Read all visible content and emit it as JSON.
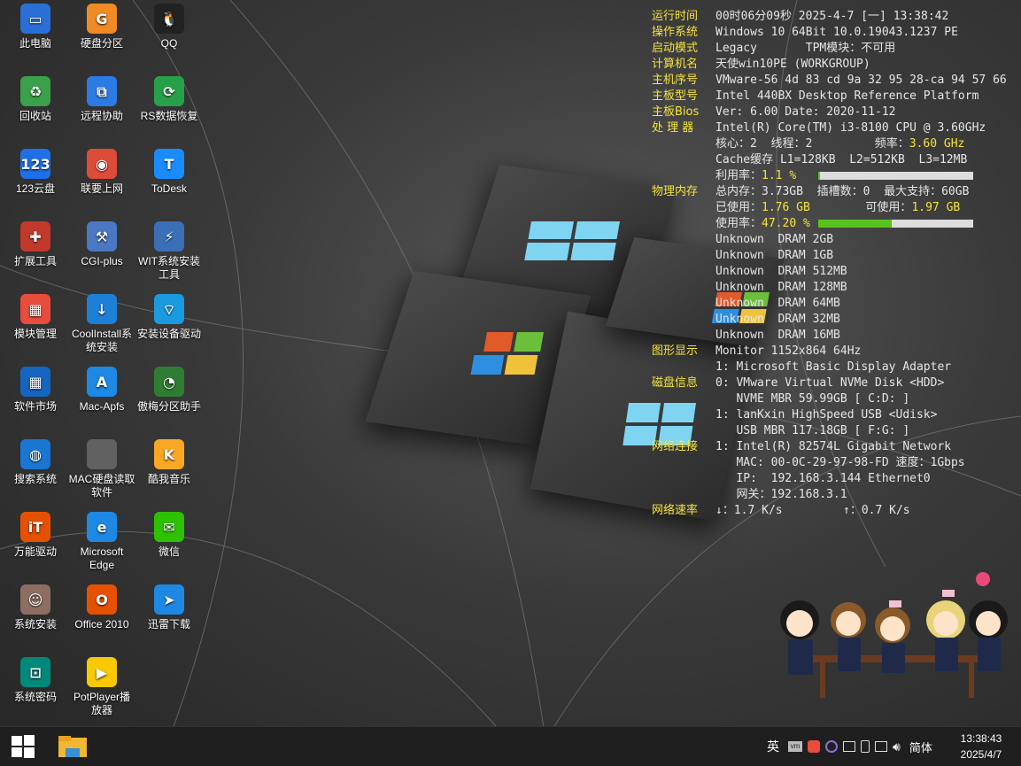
{
  "desktop_icons": [
    {
      "label": "此电脑",
      "glyph": "▭",
      "color": "#2a6fd6"
    },
    {
      "label": "硬盘分区",
      "glyph": "G",
      "color": "#f08a24"
    },
    {
      "label": "QQ",
      "glyph": "🐧",
      "color": "#222222"
    },
    {
      "label": "回收站",
      "glyph": "♻",
      "color": "#3aa04a"
    },
    {
      "label": "远程协助",
      "glyph": "⧉",
      "color": "#2c7be5"
    },
    {
      "label": "RS数据恢复",
      "glyph": "⟳",
      "color": "#27a04a"
    },
    {
      "label": "123云盘",
      "glyph": "123",
      "color": "#1e6fe8"
    },
    {
      "label": "联要上网",
      "glyph": "◉",
      "color": "#dd4b39"
    },
    {
      "label": "ToDesk",
      "glyph": "T",
      "color": "#1a8cff"
    },
    {
      "label": "扩展工具",
      "glyph": "✚",
      "color": "#c0392b"
    },
    {
      "label": "CGI-plus",
      "glyph": "⚒",
      "color": "#4a78c2"
    },
    {
      "label": "WIT系统安装工具",
      "glyph": "⚡",
      "color": "#3b6fb6"
    },
    {
      "label": "模块管理",
      "glyph": "▦",
      "color": "#e74c3c"
    },
    {
      "label": "CoolInstall系统安装",
      "glyph": "↓",
      "color": "#1d7fd6"
    },
    {
      "label": "安装设备驱动",
      "glyph": "⌔",
      "color": "#1a9be0"
    },
    {
      "label": "软件市场",
      "glyph": "▦",
      "color": "#1565c0"
    },
    {
      "label": "Mac-Apfs",
      "glyph": "A",
      "color": "#1e88e5"
    },
    {
      "label": "傲梅分区助手",
      "glyph": "◔",
      "color": "#2e7d32"
    },
    {
      "label": "搜索系统",
      "glyph": "◍",
      "color": "#1976d2"
    },
    {
      "label": "MAC硬盘读取软件",
      "glyph": "",
      "color": "#616161"
    },
    {
      "label": "酷我音乐",
      "glyph": "K",
      "color": "#f9a825"
    },
    {
      "label": "万能驱动",
      "glyph": "iT",
      "color": "#e65100"
    },
    {
      "label": "Microsoft Edge",
      "glyph": "e",
      "color": "#1e88e5"
    },
    {
      "label": "微信",
      "glyph": "✉",
      "color": "#2dc100"
    },
    {
      "label": "系统安装",
      "glyph": "☺",
      "color": "#8d6e63"
    },
    {
      "label": "Office 2010",
      "glyph": "O",
      "color": "#e65100"
    },
    {
      "label": "迅雷下载",
      "glyph": "➤",
      "color": "#1e88e5"
    },
    {
      "label": "系统密码",
      "glyph": "⊡",
      "color": "#00897b"
    },
    {
      "label": "PotPlayer播放器",
      "glyph": "▶",
      "color": "#f9c900"
    }
  ],
  "info": {
    "runtime": {
      "label": "运行时间",
      "value": "00时06分09秒 2025-4-7 [一] 13:38:42"
    },
    "os": {
      "label": "操作系统",
      "value": "Windows 10 64Bit 10.0.19043.1237 PE"
    },
    "boot": {
      "label": "启动模式",
      "value": "Legacy       TPM模块：不可用"
    },
    "computer": {
      "label": "计算机名",
      "value": "天使win10PE (WORKGROUP)"
    },
    "serial": {
      "label": "主机序号",
      "value": "VMware-56 4d 83 cd 9a 32 95 28-ca 94 57 66"
    },
    "board": {
      "label": "主板型号",
      "value": "Intel 440BX Desktop Reference Platform"
    },
    "bios": {
      "label": "主板Bios",
      "value": "Ver: 6.00 Date: 2020-11-12"
    },
    "cpu": {
      "label": "处 理 器",
      "value": "Intel(R) Core(TM) i3-8100 CPU @ 3.60GHz"
    },
    "cores": {
      "text": "核心：2  线程：2         频率：",
      "freq": "3.60 GHz"
    },
    "cache": "Cache缓存 L1=128KB  L2=512KB  L3=12MB",
    "cpu_usage": {
      "text": "利用率：",
      "value": "1.1 %",
      "fraction": 0.011
    },
    "mem": {
      "label": "物理内存",
      "total": "总内存：3.73GB  插槽数：0  最大支持：60GB"
    },
    "mem_used": {
      "text": "已使用：",
      "used": "1.76 GB",
      "avail_text": "        可使用：",
      "avail": "1.97 GB"
    },
    "mem_usage": {
      "text": "使用率：",
      "value": "47.20 %",
      "fraction": 0.472
    },
    "dimms": [
      "Unknown  DRAM 2GB",
      "Unknown  DRAM 1GB",
      "Unknown  DRAM 512MB",
      "Unknown  DRAM 128MB",
      "Unknown  DRAM 64MB",
      "Unknown  DRAM 32MB",
      "Unknown  DRAM 16MB"
    ],
    "gpu": {
      "label": "图形显示",
      "lines": [
        "Monitor 1152x864 64Hz",
        "1: Microsoft Basic Display Adapter"
      ]
    },
    "disk": {
      "label": "磁盘信息",
      "lines": [
        "0: VMware Virtual NVMe Disk <HDD>",
        "   NVME MBR 59.99GB [ C:D: ]",
        "1: lanKxin HighSpeed USB <Udisk>",
        "   USB MBR 117.18GB [ F:G: ]"
      ]
    },
    "net": {
      "label": "网络连接",
      "lines": [
        "1: Intel(R) 82574L Gigabit Network",
        "   MAC: 00-0C-29-97-98-FD 速度：1Gbps",
        "   IP:  192.168.3.144 Ethernet0",
        "   网关：192.168.3.1"
      ]
    },
    "speed": {
      "label": "网络速率",
      "down": "↓：1.7 K/s",
      "up": "↑：0.7 K/s"
    }
  },
  "taskbar": {
    "ime": "英",
    "lang": "简体",
    "time": "13:38:43",
    "date": "2025/4/7"
  }
}
